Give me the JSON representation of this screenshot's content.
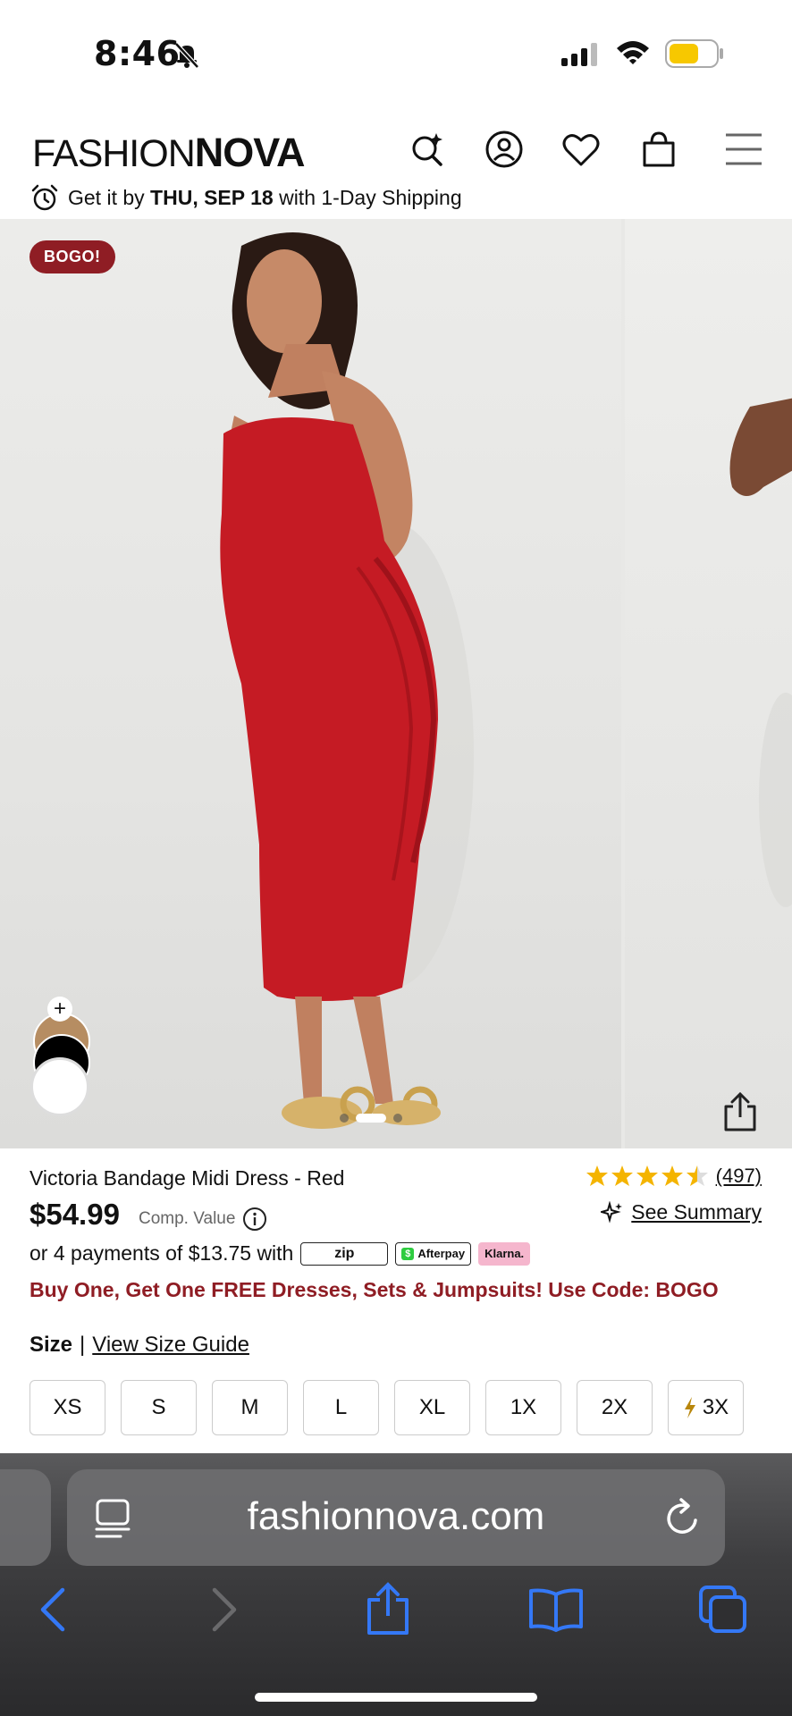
{
  "status_bar": {
    "time": "8:46"
  },
  "header": {
    "logo_light": "FASHION",
    "logo_bold": "NOVA",
    "shipping_prefix": "Get it by ",
    "shipping_date": "THU, SEP 18",
    "shipping_suffix": " with 1-Day Shipping"
  },
  "gallery": {
    "badge": "BOGO!",
    "swatch_add": "+"
  },
  "product": {
    "name": "Victoria Bandage Midi Dress - Red",
    "rating": 4.5,
    "review_count": "(497)",
    "price": "$54.99",
    "comp_value_label": "Comp. Value",
    "see_summary": "See Summary",
    "payments_text": "or 4 payments of $13.75 with",
    "pay_providers": [
      "zip",
      "Afterpay",
      "Klarna."
    ],
    "promo": "Buy One, Get One FREE Dresses, Sets & Jumpsuits! Use Code: BOGO",
    "size_label": "Size",
    "size_divider": "|",
    "size_guide": "View Size Guide",
    "sizes": [
      "XS",
      "S",
      "M",
      "L",
      "XL",
      "1X",
      "2X",
      "3X"
    ]
  },
  "browser": {
    "url": "fashionnova.com"
  },
  "colors": {
    "accent_red": "#8f1d24",
    "star": "#f4b400",
    "ios_blue": "#3478f6"
  }
}
